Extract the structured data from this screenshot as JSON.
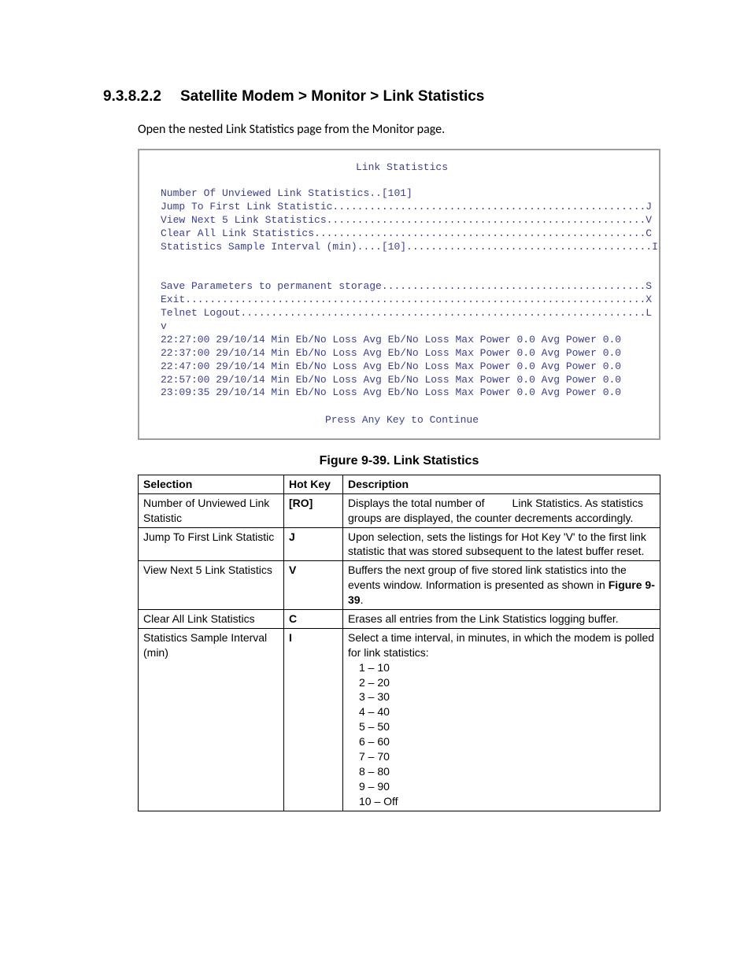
{
  "heading": {
    "number": "9.3.8.2.2",
    "title": "Satellite Modem > Monitor > Link Statistics"
  },
  "intro": "Open the nested Link Statistics page from the Monitor page.",
  "terminal": {
    "title": "Link Statistics",
    "lines": [
      "Number Of Unviewed Link Statistics..[101]",
      "Jump To First Link Statistic...................................................J",
      "View Next 5 Link Statistics....................................................V",
      "Clear All Link Statistics......................................................C",
      "Statistics Sample Interval (min)....[10]........................................I",
      "",
      "",
      "Save Parameters to permanent storage...........................................S",
      "Exit...........................................................................X",
      "Telnet Logout..................................................................L",
      "v",
      "22:27:00 29/10/14 Min Eb/No Loss Avg Eb/No Loss Max Power 0.0 Avg Power 0.0",
      "22:37:00 29/10/14 Min Eb/No Loss Avg Eb/No Loss Max Power 0.0 Avg Power 0.0",
      "22:47:00 29/10/14 Min Eb/No Loss Avg Eb/No Loss Max Power 0.0 Avg Power 0.0",
      "22:57:00 29/10/14 Min Eb/No Loss Avg Eb/No Loss Max Power 0.0 Avg Power 0.0",
      "23:09:35 29/10/14 Min Eb/No Loss Avg Eb/No Loss Max Power 0.0 Avg Power 0.0"
    ],
    "footer": "Press Any Key to Continue"
  },
  "figure_caption": "Figure 9-39. Link Statistics",
  "table": {
    "headers": {
      "c1": "Selection",
      "c2": "Hot Key",
      "c3": "Description"
    },
    "rows": [
      {
        "sel": "Number of Unviewed Link Statistic",
        "hk": "[RO]",
        "desc_pre": "Displays the total number of ",
        "desc_gap": "        ",
        "desc_post": "Link Statistics. As statistics groups are displayed, the counter decrements accordingly."
      },
      {
        "sel": "Jump To First Link Statistic",
        "hk": "J",
        "desc": "Upon selection, sets the listings for Hot Key 'V' to the first link statistic that was stored subsequent to the latest buffer reset."
      },
      {
        "sel": "View Next 5 Link Statistics",
        "hk": "V",
        "desc_pre": "Buffers the next group of five stored link statistics into the events window. Information is presented as shown in ",
        "desc_bold": "Figure 9-39",
        "desc_post": "."
      },
      {
        "sel": "Clear All Link Statistics",
        "hk": "C",
        "desc": "Erases all entries from the Link Statistics logging buffer."
      },
      {
        "sel": "Statistics Sample Interval (min)",
        "hk": "I",
        "desc_lead": "Select a time interval, in minutes, in which the modem is polled for link statistics:",
        "intervals": [
          "1 – 10",
          "2 – 20",
          "3 – 30",
          "4 – 40",
          "5 – 50",
          "6 – 60",
          "7 – 70",
          "8 – 80",
          "9 – 90",
          "10 – Off"
        ]
      }
    ]
  }
}
